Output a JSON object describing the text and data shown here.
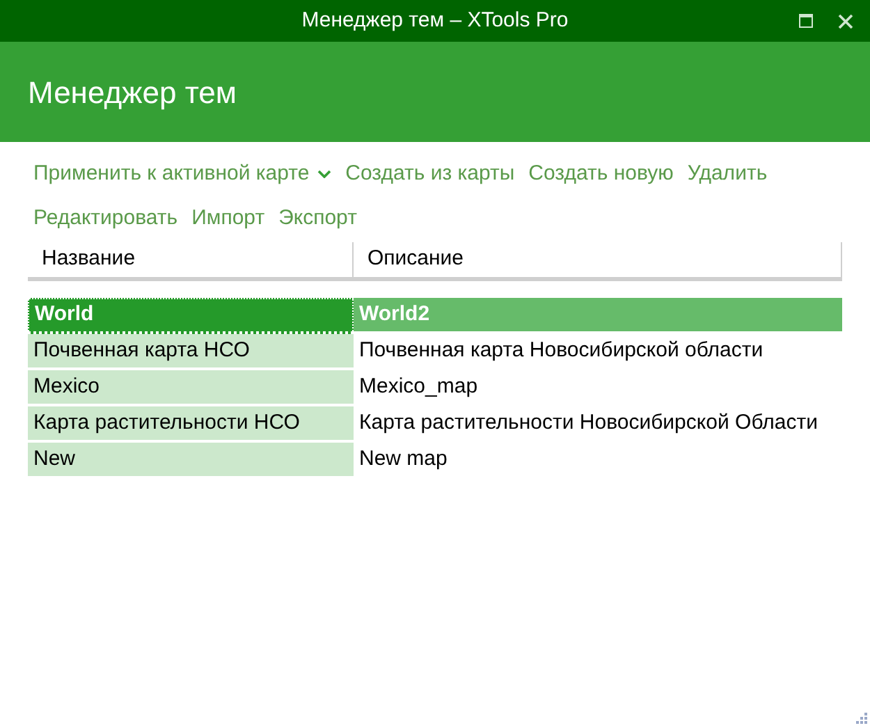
{
  "window": {
    "title": "Менеджер тем – XTools Pro"
  },
  "header": {
    "title": "Менеджер тем"
  },
  "toolbar": [
    {
      "label": "Применить к активной карте",
      "kind": "dropdown"
    },
    {
      "label": "Создать из карты",
      "kind": "button"
    },
    {
      "label": "Создать новую",
      "kind": "button"
    },
    {
      "label": "Удалить",
      "kind": "button"
    },
    {
      "label": "Редактировать",
      "kind": "button"
    },
    {
      "label": "Импорт",
      "kind": "button"
    },
    {
      "label": "Экспорт",
      "kind": "button"
    }
  ],
  "table": {
    "columns": [
      "Название",
      "Описание"
    ],
    "rows": [
      {
        "cells": [
          "World",
          "World2"
        ],
        "selected": true
      },
      {
        "cells": [
          "Почвенная карта НСО",
          "Почвенная карта Новосибирской области"
        ],
        "selected": false
      },
      {
        "cells": [
          "Mexico",
          "Mexico_map"
        ],
        "selected": false
      },
      {
        "cells": [
          "Карта растительности НСО",
          "Карта растительности Новосибирской Области"
        ],
        "selected": false
      },
      {
        "cells": [
          "New",
          "New map"
        ],
        "selected": false
      }
    ]
  }
}
